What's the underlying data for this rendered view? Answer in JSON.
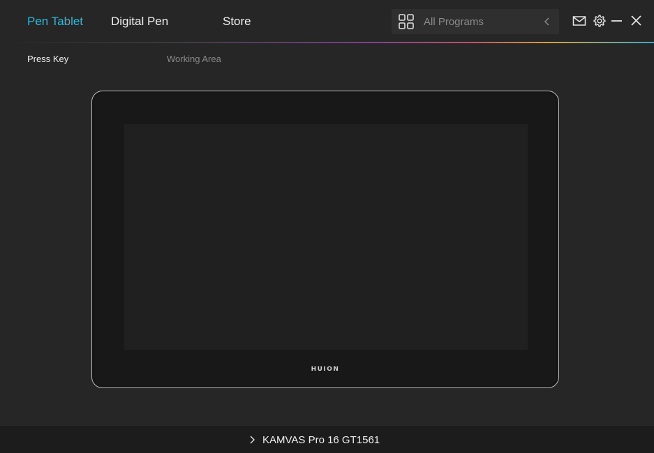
{
  "nav": {
    "tabs": [
      {
        "label": "Pen Tablet",
        "active": true
      },
      {
        "label": "Digital Pen",
        "active": false
      },
      {
        "label": "Store",
        "active": false
      }
    ],
    "accent_color": "#2fb8d6"
  },
  "program_selector": {
    "label": "All Programs",
    "icon": "grid-icon",
    "chevron": "chevron-left-icon"
  },
  "window_controls": {
    "icons": [
      "mail-icon",
      "gear-icon",
      "minimize-icon",
      "close-icon"
    ]
  },
  "sub_tabs": [
    {
      "label": "Press Key",
      "active": true
    },
    {
      "label": "Working Area",
      "active": false
    }
  ],
  "tablet": {
    "logo": "HUION"
  },
  "device": {
    "name": "KAMVAS Pro 16 GT1561",
    "icon": "chevron-right-icon"
  }
}
